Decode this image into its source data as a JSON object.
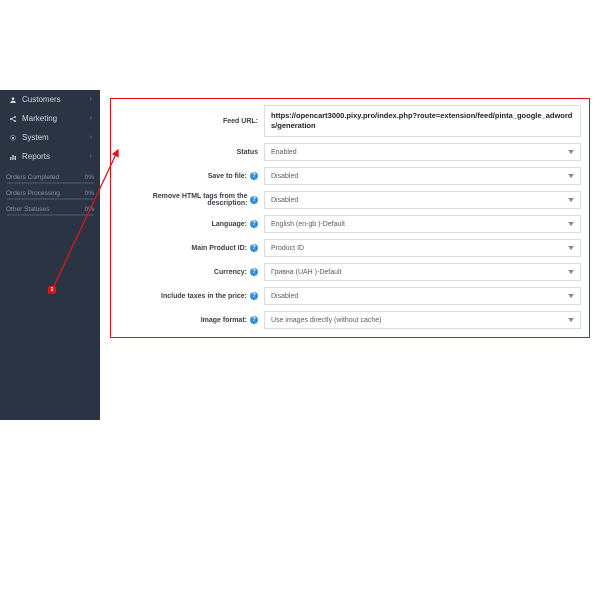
{
  "sidebar": {
    "items": [
      {
        "icon": "👤",
        "label": "Customers"
      },
      {
        "icon": "⠪",
        "label": "Marketing"
      },
      {
        "icon": "⚙",
        "label": "System"
      },
      {
        "icon": "📊",
        "label": "Reports"
      }
    ],
    "stats": [
      {
        "label": "Orders Completed",
        "value": "0%"
      },
      {
        "label": "Orders Processing",
        "value": "0%"
      },
      {
        "label": "Other Statuses",
        "value": "0%"
      }
    ]
  },
  "form": {
    "feed_url_label": "Feed URL:",
    "feed_url_value": "https://opencart3000.pixy.pro/index.php?route=extension/feed/pinta_google_adwords/generation",
    "rows": [
      {
        "label": "Status",
        "help": false,
        "value": "Enabled"
      },
      {
        "label": "Save to file:",
        "help": true,
        "value": "Disabled"
      },
      {
        "label": "Remove HTML tags from the description:",
        "help": true,
        "value": "Disabled"
      },
      {
        "label": "Language:",
        "help": true,
        "value": "English (en-gb )-Default"
      },
      {
        "label": "Main Product ID:",
        "help": true,
        "value": "Product ID"
      },
      {
        "label": "Currency:",
        "help": true,
        "value": "Гривна (UAH )-Default"
      },
      {
        "label": "Include taxes in the price:",
        "help": true,
        "value": "Disabled"
      },
      {
        "label": "Image format:",
        "help": true,
        "value": "Use images directly (without cache)"
      }
    ]
  },
  "annotation": {
    "number": "2"
  }
}
